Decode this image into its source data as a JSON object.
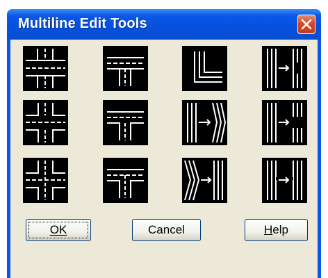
{
  "dialog": {
    "title": "Multiline Edit Tools",
    "close_icon": "close-x-icon",
    "accent_color": "#0a54e6",
    "close_color": "#d9472a"
  },
  "tools": [
    {
      "id": "closed-cross",
      "icon": "mline-closed-cross-icon"
    },
    {
      "id": "closed-tee",
      "icon": "mline-closed-tee-icon"
    },
    {
      "id": "corner-joint",
      "icon": "mline-corner-joint-icon"
    },
    {
      "id": "cut-single",
      "icon": "mline-cut-single-icon"
    },
    {
      "id": "open-cross",
      "icon": "mline-open-cross-icon"
    },
    {
      "id": "open-tee",
      "icon": "mline-open-tee-icon"
    },
    {
      "id": "add-vertex",
      "icon": "mline-add-vertex-icon"
    },
    {
      "id": "cut-all",
      "icon": "mline-cut-all-icon"
    },
    {
      "id": "merged-cross",
      "icon": "mline-merged-cross-icon"
    },
    {
      "id": "merged-tee",
      "icon": "mline-merged-tee-icon"
    },
    {
      "id": "delete-vertex",
      "icon": "mline-delete-vertex-icon"
    },
    {
      "id": "weld-all",
      "icon": "mline-weld-all-icon"
    }
  ],
  "buttons": {
    "ok": {
      "label": "OK",
      "mnemonic": "O"
    },
    "cancel": {
      "label": "Cancel"
    },
    "help": {
      "label": "Help",
      "mnemonic": "H"
    }
  }
}
